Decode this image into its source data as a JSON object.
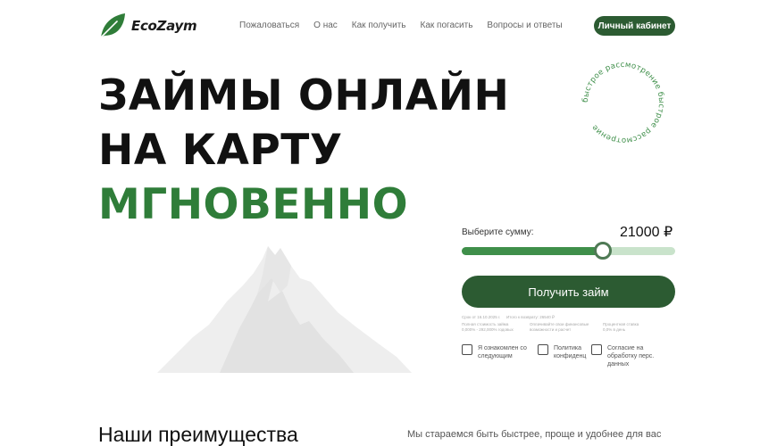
{
  "header": {
    "brand": "EcoZaym",
    "nav": [
      "Пожаловаться",
      "О нас",
      "Как получить",
      "Как погасить",
      "Вопросы и ответы"
    ],
    "cabinet_label": "Личный кабинет"
  },
  "hero": {
    "line1": "ЗАЙМЫ ОНЛАЙН",
    "line2": "НА КАРТУ",
    "line3": "МГНОВЕННО",
    "badge_text": "быстрое рассмотрение быстрое рассмотрение"
  },
  "calculator": {
    "sum_label": "Выберите сумму:",
    "sum_value": "21000 ₽",
    "slider_fraction": 0.66,
    "submit_label": "Получить займ",
    "fine_print": [
      [
        "Срок от 16.10.2025 г.",
        "Итого к возврату: 26540 ₽"
      ],
      [
        "Полная стоимость займа",
        "0,000% - 292,000% годовых"
      ],
      [
        "Оплачивайте свои финансовые",
        "возможности и расчет"
      ],
      [
        "Процентная ставка",
        "0,0% в день"
      ]
    ],
    "consents": [
      "Я ознакомлен со следующим",
      "Политика конфиденц",
      "Согласие на обработку перс. данных"
    ]
  },
  "advantages": {
    "title": "Наши преимущества",
    "text": "Мы стараемся быть быстрее, проще и удобнее для вас"
  },
  "colors": {
    "brand_green": "#2c5b32",
    "accent_green": "#2f7d39",
    "slider_track": "#c9e3cb"
  }
}
